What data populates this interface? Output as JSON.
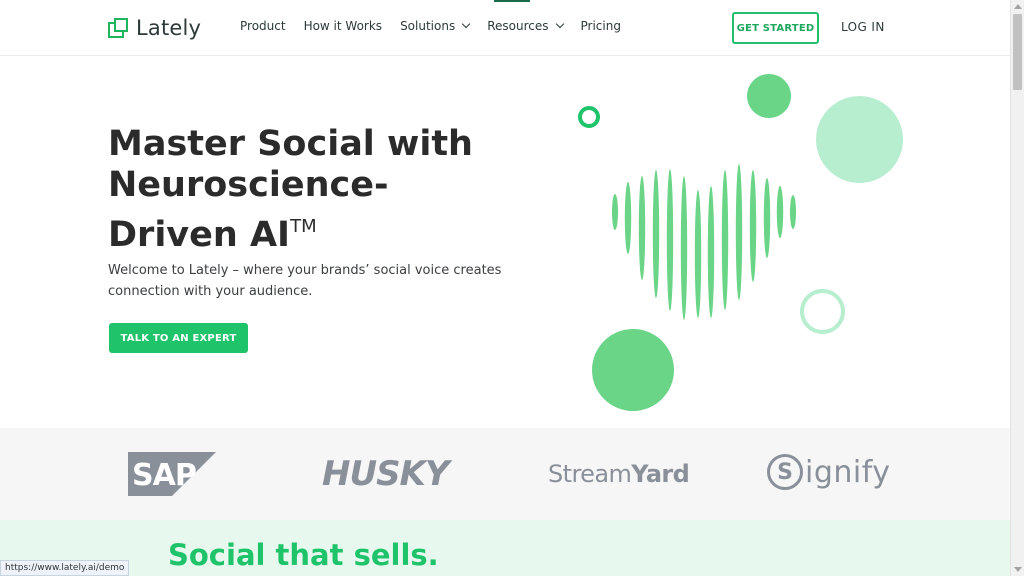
{
  "brand": {
    "name": "Lately",
    "accent": "#1fc36a",
    "accent_light": "#b7eed0"
  },
  "nav": {
    "items": [
      {
        "label": "Product",
        "has_dropdown": false
      },
      {
        "label": "How it Works",
        "has_dropdown": false
      },
      {
        "label": "Solutions",
        "has_dropdown": true
      },
      {
        "label": "Resources",
        "has_dropdown": true
      },
      {
        "label": "Pricing",
        "has_dropdown": false
      }
    ],
    "cta_label": "GET STARTED",
    "login_label": "LOG IN"
  },
  "hero": {
    "title_line1": "Master Social with",
    "title_line2": "Neuroscience-",
    "title_line3": "Driven AI",
    "title_tm": "TM",
    "subtitle": "Welcome to Lately – where your brands’ social voice creates connection with your audience.",
    "cta_label": "TALK TO AN EXPERT"
  },
  "logos": {
    "sap": "SAP",
    "husky": "HUSKY",
    "streamyard_a": "Stream",
    "streamyard_b": "Yard",
    "signify_s": "S",
    "signify_rest": "ignify"
  },
  "section2": {
    "heading": "Social that sells."
  },
  "status_bar": {
    "url": "https://www.lately.ai/demo"
  }
}
